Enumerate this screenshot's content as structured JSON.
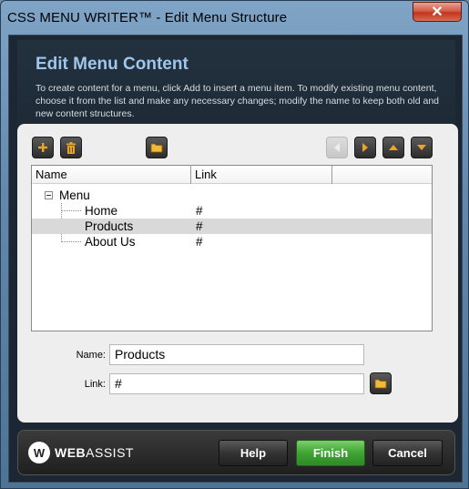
{
  "window": {
    "title": "CSS MENU WRITER™ - Edit Menu Structure",
    "close_glyph": "✕"
  },
  "header": {
    "title": "Edit Menu Content",
    "description": "To create content for a menu, click Add to insert a menu item. To modify existing menu content, choose it from the list and make any necessary changes; modify the name to keep both old and new content structures."
  },
  "toolbar": {
    "add_icon": "plus-icon",
    "delete_icon": "trash-icon",
    "browse_icon": "folder-icon",
    "left_icon": "arrow-left-icon",
    "right_icon": "arrow-right-icon",
    "up_icon": "arrow-up-icon",
    "down_icon": "arrow-down-icon"
  },
  "tree": {
    "columns": [
      "Name",
      "Link"
    ],
    "root": "Menu",
    "items": [
      {
        "name": "Home",
        "link": "#"
      },
      {
        "name": "Products",
        "link": "#"
      },
      {
        "name": "About Us",
        "link": "#"
      }
    ],
    "selected_index": 1
  },
  "form": {
    "name_label": "Name:",
    "name_value": "Products",
    "link_label": "Link:",
    "link_value": "#"
  },
  "footer": {
    "logo_text_bold": "WEB",
    "logo_text_rest": "ASSIST",
    "help_label": "Help",
    "finish_label": "Finish",
    "cancel_label": "Cancel"
  },
  "colors": {
    "accent_title": "#9fc7ec",
    "finish_green": "#3fa333",
    "selection": "#d9d9d9"
  }
}
